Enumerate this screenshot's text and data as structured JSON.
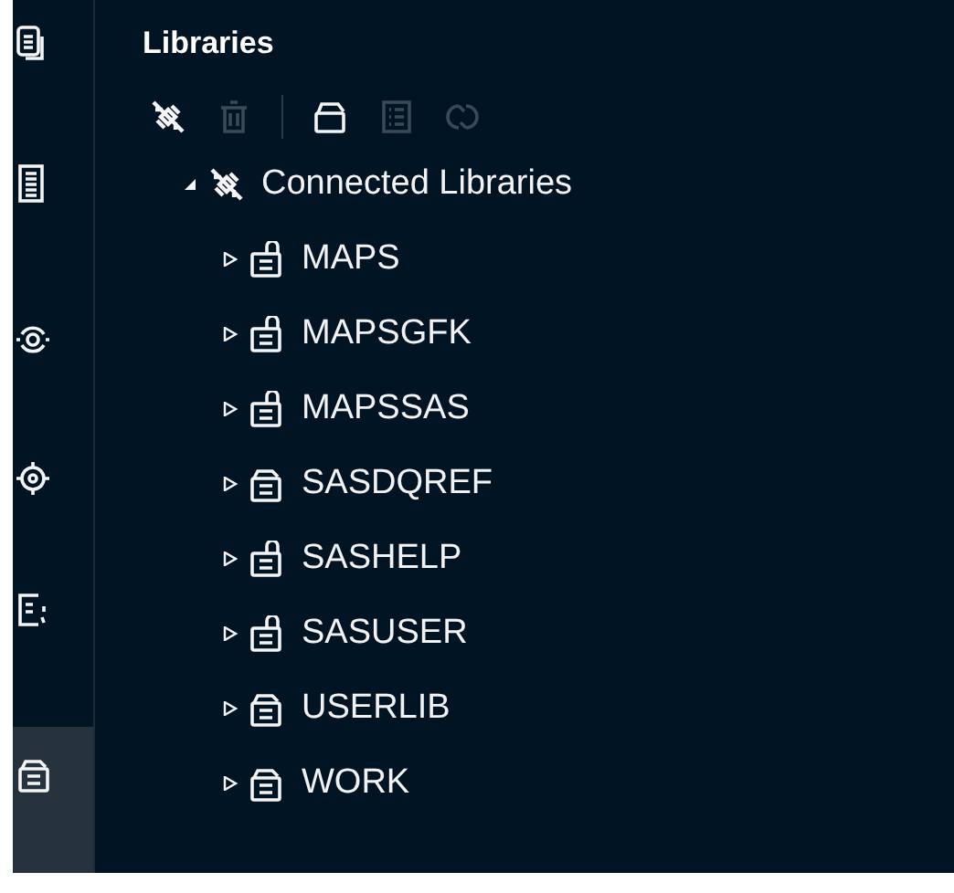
{
  "activity_bar": [
    {
      "kind": "explorer",
      "selected": false
    },
    {
      "kind": "notebook",
      "selected": false
    },
    {
      "kind": "connection",
      "selected": false
    },
    {
      "kind": "target",
      "selected": false
    },
    {
      "kind": "tasks",
      "selected": false
    },
    {
      "kind": "libraries",
      "selected": true
    }
  ],
  "panel": {
    "title": "Libraries"
  },
  "toolbar": [
    {
      "kind": "disconnect",
      "disabled": false
    },
    {
      "kind": "delete",
      "disabled": true
    },
    {
      "kind": "separator"
    },
    {
      "kind": "open",
      "disabled": false
    },
    {
      "kind": "details",
      "disabled": true
    },
    {
      "kind": "refresh",
      "disabled": true
    }
  ],
  "tree": {
    "label": "Connected Libraries",
    "expanded": true,
    "children": [
      {
        "label": "MAPS",
        "expanded": false,
        "locked": true
      },
      {
        "label": "MAPSGFK",
        "expanded": false,
        "locked": true
      },
      {
        "label": "MAPSSAS",
        "expanded": false,
        "locked": true
      },
      {
        "label": "SASDQREF",
        "expanded": false,
        "locked": false
      },
      {
        "label": "SASHELP",
        "expanded": false,
        "locked": true
      },
      {
        "label": "SASUSER",
        "expanded": false,
        "locked": true
      },
      {
        "label": "USERLIB",
        "expanded": false,
        "locked": false
      },
      {
        "label": "WORK",
        "expanded": false,
        "locked": false
      }
    ]
  }
}
